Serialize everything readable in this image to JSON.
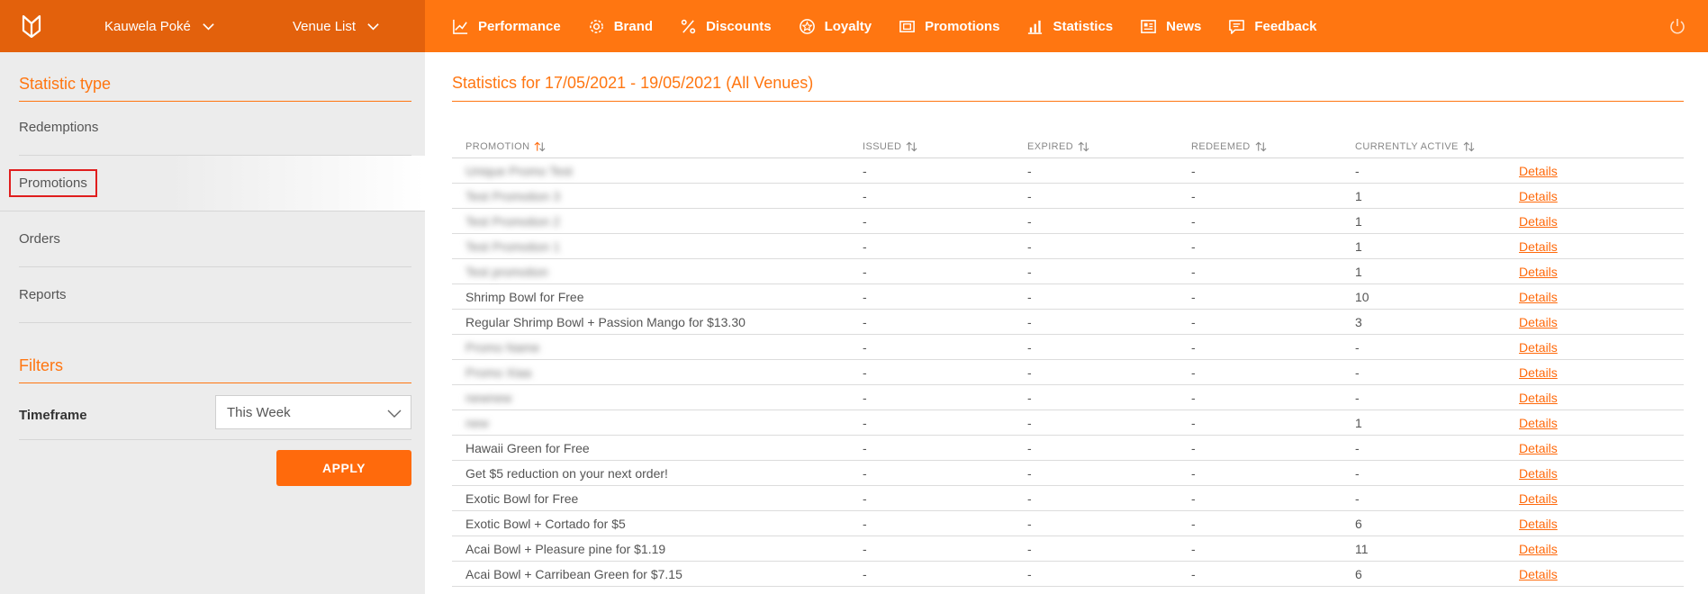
{
  "header": {
    "brand_select": "Kauwela Poké",
    "venue_select": "Venue List",
    "nav": [
      {
        "label": "Performance",
        "icon": "trend-chart-icon"
      },
      {
        "label": "Brand",
        "icon": "gear-icon"
      },
      {
        "label": "Discounts",
        "icon": "percent-icon"
      },
      {
        "label": "Loyalty",
        "icon": "star-circle-icon"
      },
      {
        "label": "Promotions",
        "icon": "ticket-icon"
      },
      {
        "label": "Statistics",
        "icon": "bar-chart-icon"
      },
      {
        "label": "News",
        "icon": "newspaper-icon"
      },
      {
        "label": "Feedback",
        "icon": "speech-bubble-icon"
      }
    ]
  },
  "sidebar": {
    "statistic_type_heading": "Statistic type",
    "items": [
      "Redemptions",
      "Promotions",
      "Orders",
      "Reports"
    ],
    "active_item": "Promotions",
    "filters_heading": "Filters",
    "timeframe_label": "Timeframe",
    "timeframe_value": "This Week",
    "apply_label": "APPLY"
  },
  "main": {
    "title": "Statistics for 17/05/2021 - 19/05/2021 (All Venues)",
    "columns": [
      "PROMOTION",
      "ISSUED",
      "EXPIRED",
      "REDEEMED",
      "CURRENTLY ACTIVE"
    ],
    "details_label": "Details",
    "rows": [
      {
        "name": "Unique Promo Test",
        "blurred": true,
        "issued": "-",
        "expired": "-",
        "redeemed": "-",
        "active": "-"
      },
      {
        "name": "Test Promotion 3",
        "blurred": true,
        "issued": "-",
        "expired": "-",
        "redeemed": "-",
        "active": "1"
      },
      {
        "name": "Test Promotion 2",
        "blurred": true,
        "issued": "-",
        "expired": "-",
        "redeemed": "-",
        "active": "1"
      },
      {
        "name": "Test Promotion 1",
        "blurred": true,
        "issued": "-",
        "expired": "-",
        "redeemed": "-",
        "active": "1"
      },
      {
        "name": "Test promotion",
        "blurred": true,
        "issued": "-",
        "expired": "-",
        "redeemed": "-",
        "active": "1"
      },
      {
        "name": "Shrimp Bowl for Free",
        "blurred": false,
        "issued": "-",
        "expired": "-",
        "redeemed": "-",
        "active": "10"
      },
      {
        "name": "Regular Shrimp Bowl + Passion Mango for $13.30",
        "blurred": false,
        "issued": "-",
        "expired": "-",
        "redeemed": "-",
        "active": "3"
      },
      {
        "name": "Promo Name",
        "blurred": true,
        "issued": "-",
        "expired": "-",
        "redeemed": "-",
        "active": "-"
      },
      {
        "name": "Promo Xiaa",
        "blurred": true,
        "issued": "-",
        "expired": "-",
        "redeemed": "-",
        "active": "-"
      },
      {
        "name": "newnew",
        "blurred": true,
        "issued": "-",
        "expired": "-",
        "redeemed": "-",
        "active": "-"
      },
      {
        "name": "new",
        "blurred": true,
        "issued": "-",
        "expired": "-",
        "redeemed": "-",
        "active": "1"
      },
      {
        "name": "Hawaii Green for Free",
        "blurred": false,
        "issued": "-",
        "expired": "-",
        "redeemed": "-",
        "active": "-"
      },
      {
        "name": "Get $5 reduction on your next order!",
        "blurred": false,
        "issued": "-",
        "expired": "-",
        "redeemed": "-",
        "active": "-"
      },
      {
        "name": "Exotic Bowl for Free",
        "blurred": false,
        "issued": "-",
        "expired": "-",
        "redeemed": "-",
        "active": "-"
      },
      {
        "name": "Exotic Bowl + Cortado for $5",
        "blurred": false,
        "issued": "-",
        "expired": "-",
        "redeemed": "-",
        "active": "6"
      },
      {
        "name": "Acai Bowl + Pleasure pine for $1.19",
        "blurred": false,
        "issued": "-",
        "expired": "-",
        "redeemed": "-",
        "active": "11"
      },
      {
        "name": "Acai Bowl + Carribean Green for $7.15",
        "blurred": false,
        "issued": "-",
        "expired": "-",
        "redeemed": "-",
        "active": "6"
      }
    ]
  },
  "colors": {
    "accent": "#ff7611",
    "header_dark": "#e3610c",
    "sidebar_bg": "#ececec",
    "highlight_box": "#e01e1e"
  }
}
